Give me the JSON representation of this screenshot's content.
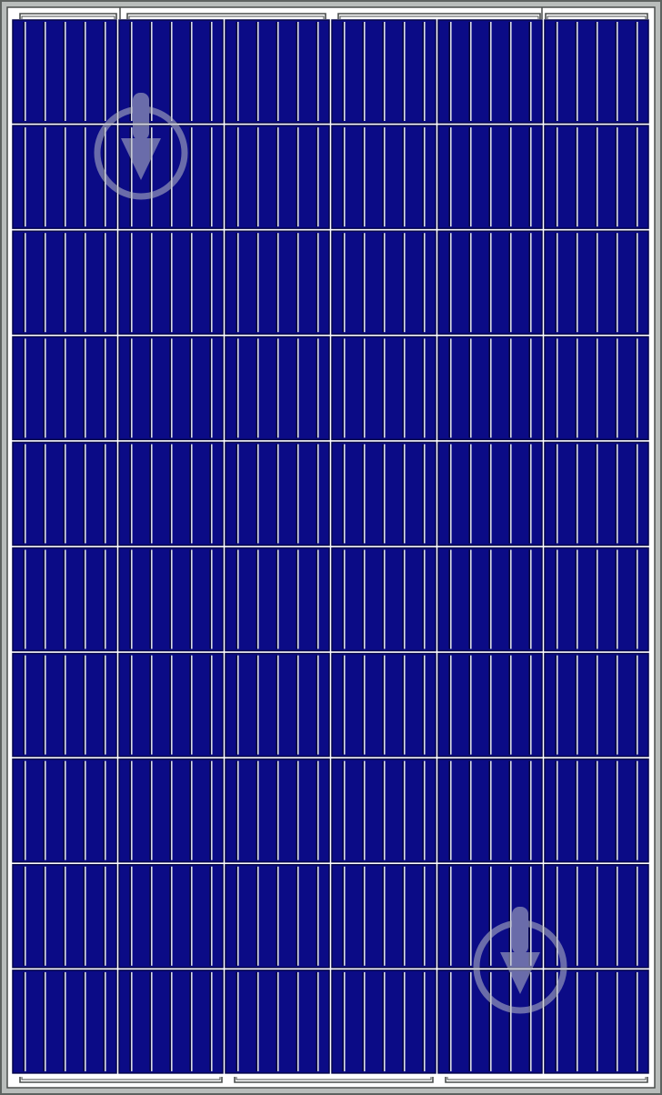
{
  "panel": {
    "columns": 6,
    "rows": 10,
    "busbars_per_cell": 5,
    "colors": {
      "frame_outer": "#5e6360",
      "frame_fill": "#b9bdbb",
      "frame_inner": "#4a4e4c",
      "backsheet": "#ffffff",
      "cell": "#0b0b86",
      "cell_edge": "#05054a",
      "busbar": "#d8dce6",
      "busbar_shadow": "#05052e",
      "ribbon": "#4a4e4c",
      "watermark": "#b8bcc8"
    },
    "watermark": {
      "icon": "download-arrow-icon",
      "count": 2
    }
  }
}
